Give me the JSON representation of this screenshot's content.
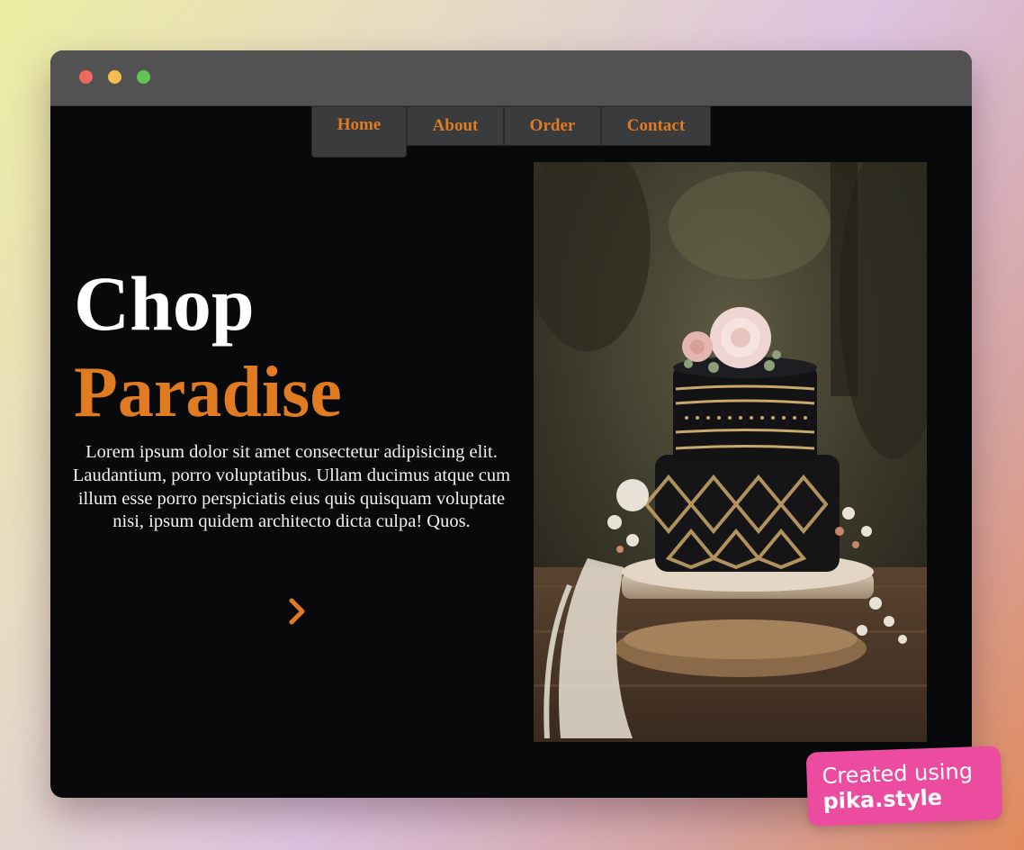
{
  "window": {
    "controls": [
      "close",
      "minimize",
      "maximize"
    ]
  },
  "nav": {
    "items": [
      {
        "label": "Home",
        "active": true
      },
      {
        "label": "About",
        "active": false
      },
      {
        "label": "Order",
        "active": false
      },
      {
        "label": "Contact",
        "active": false
      }
    ]
  },
  "hero": {
    "title_line1": "Chop",
    "title_line2": "Paradise",
    "description": "Lorem ipsum dolor sit amet consectetur adipisicing elit. Laudantium, porro voluptatibus. Ullam ducimus atque cum illum esse porro perspiciatis eius quis quisquam voluptate nisi, ipsum quidem architecto dicta culpa! Quos.",
    "next_icon": "chevron-right-icon"
  },
  "image": {
    "subject": "two-tier black and gold cake with roses on wooden stand"
  },
  "badge": {
    "line1": "Created using",
    "line2": "pika.style"
  },
  "colors": {
    "accent": "#e07b22",
    "page_bg": "#08090b",
    "titlebar": "#525252",
    "nav_bg": "#3a3b3d",
    "badge": "#ec4c9f"
  }
}
